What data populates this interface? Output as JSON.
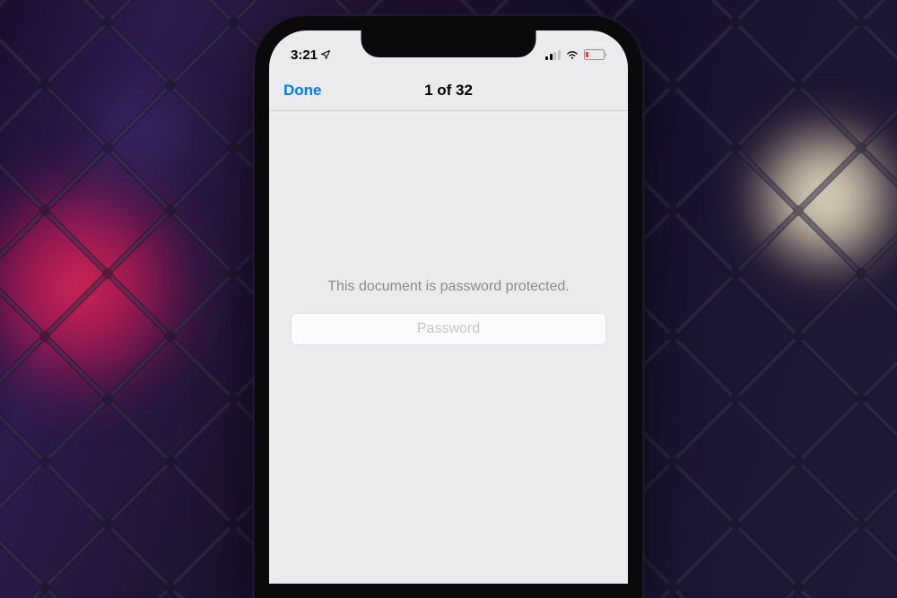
{
  "status_bar": {
    "time": "3:21",
    "location_active": true
  },
  "nav": {
    "done_label": "Done",
    "title": "1 of 32"
  },
  "content": {
    "message": "This document is password protected.",
    "password_placeholder": "Password"
  }
}
